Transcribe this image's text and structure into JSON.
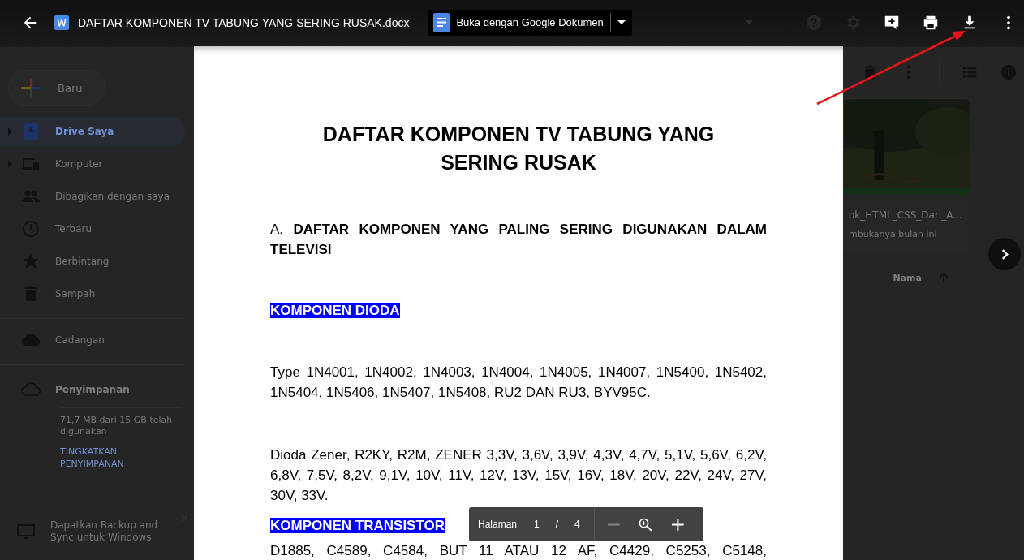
{
  "topbar": {
    "file_title": "DAFTAR KOMPONEN TV TABUNG YANG SERING RUSAK.docx",
    "open_with": "Buka dengan Google Dokumen"
  },
  "drive": {
    "new_button": "Baru",
    "sidebar": [
      {
        "kind": "my-drive",
        "label": "Drive Saya",
        "selected": true,
        "expandable": true
      },
      {
        "kind": "computers",
        "label": "Komputer",
        "selected": false,
        "expandable": true
      },
      {
        "kind": "shared",
        "label": "Dibagikan dengan saya",
        "selected": false,
        "expandable": false
      },
      {
        "kind": "recent",
        "label": "Terbaru",
        "selected": false,
        "expandable": false
      },
      {
        "kind": "starred",
        "label": "Berbintang",
        "selected": false,
        "expandable": false
      },
      {
        "kind": "trash",
        "label": "Sampah",
        "selected": false,
        "expandable": false
      },
      {
        "kind": "backup",
        "label": "Cadangan",
        "selected": false,
        "expandable": false
      }
    ],
    "storage": {
      "title": "Penyimpanan",
      "usage": "71,7 MB dari 15 GB telah digunakan",
      "upgrade": "TINGKATKAN PENYIMPANAN"
    },
    "banner": {
      "text": "Dapatkan Backup and Sync untuk Windows"
    },
    "quick_access": {
      "kind": "picture",
      "file_name": "ok_HTML_CSS_Dari_A...",
      "detail": "mbukanya bulan ini"
    },
    "sort": {
      "label": "Nama"
    }
  },
  "document": {
    "title": "DAFTAR KOMPONEN TV TABUNG YANG SERING RUSAK",
    "blocks": [
      {
        "kind": "heading",
        "text": "A. **DAFTAR KOMPONEN YANG PALING SERING DIGUNAKAN DALAM TELEVISI**"
      },
      {
        "kind": "highlight",
        "text": "KOMPONEN DIODA"
      },
      {
        "kind": "paragraph",
        "text": "Type 1N4001, 1N4002, 1N4003, 1N4004, 1N4005, 1N4007, 1N5400, 1N5402, 1N5404, 1N5406, 1N5407, 1N5408, RU2 DAN RU3, BYV95C."
      },
      {
        "kind": "paragraph",
        "text": "Dioda Zener, R2KY, R2M, ZENER 3,3V, 3,6V, 3,9V, 4,3V, 4,7V, 5,1V, 5,6V, 6,2V, 6,8V, 7,5V, 8,2V, 9,1V, 10V, 11V, 12V, 13V, 15V, 16V, 18V, 20V, 22V, 24V, 27V, 30V, 33V."
      },
      {
        "kind": "highlight",
        "text": "KOMPONEN TRANSISTOR"
      },
      {
        "kind": "cut-line",
        "text": "D1885, C4589, C4584, BUT 11 ATAU 12 AF, C4429, C5253, C5148,"
      }
    ]
  },
  "page_controls": {
    "label": "Halaman",
    "current": "1",
    "separator": "/",
    "total": "4"
  }
}
